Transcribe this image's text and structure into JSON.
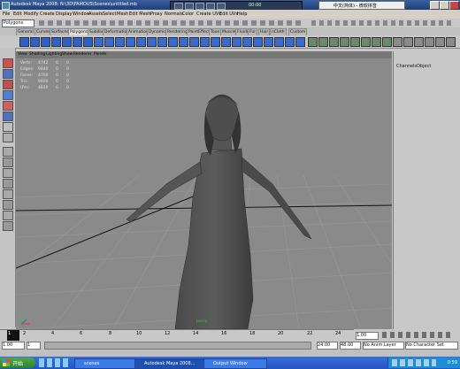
{
  "window": {
    "title": "Autodesk Maya 2008: N:\\3D\\FAMOUS\\Scenes\\untitled.mb",
    "media_time": "00:00"
  },
  "ime": {
    "label": "中文(简体) - 微软拼音"
  },
  "menus": [
    "File",
    "Edit",
    "Modify",
    "Create",
    "Display",
    "Window",
    "Assets",
    "Select",
    "Mesh",
    "Edit Mesh",
    "Proxy",
    "Normals",
    "Color",
    "Create UVs",
    "Edit UVs",
    "Help"
  ],
  "status": {
    "mode": "Polygons"
  },
  "shelf_tabs": [
    "General",
    "Curves",
    "Surfaces",
    "Polygons",
    "Subdivs",
    "Deformation",
    "Animation",
    "Dynamics",
    "Rendering",
    "PaintEffects",
    "Toon",
    "Muscle",
    "Fluids",
    "Fur",
    "Hair",
    "nCloth",
    "Custom"
  ],
  "viewport": {
    "menu": [
      "View",
      "Shading",
      "Lighting",
      "Show",
      "Renderer",
      "Panels"
    ],
    "hud": [
      {
        "label": "Verts:",
        "value": "4742",
        "a": "0",
        "b": "0"
      },
      {
        "label": "Edges:",
        "value": "9440",
        "a": "0",
        "b": "0"
      },
      {
        "label": "Faces:",
        "value": "4700",
        "a": "0",
        "b": "0"
      },
      {
        "label": "Tris:",
        "value": "9400",
        "a": "0",
        "b": "0"
      },
      {
        "label": "UVs:",
        "value": "4820",
        "a": "0",
        "b": "0"
      }
    ],
    "camera_label": "persp"
  },
  "channel_box": {
    "tabs": [
      "Channels",
      "Object"
    ]
  },
  "timeline": {
    "ticks": [
      "1",
      "2",
      "4",
      "6",
      "8",
      "10",
      "12",
      "14",
      "16",
      "18",
      "20",
      "22",
      "24"
    ],
    "current_frame": "1.00"
  },
  "range": {
    "start": "1.00",
    "mid_start": "1",
    "end": "24.00",
    "end_total": "48.00",
    "anim_layer": "No Anim Layer",
    "char_set": "No Character Set"
  },
  "taskbar": {
    "start_label": "开始",
    "tasks": [
      "scenes",
      "Autodesk Maya 2008...",
      "Output Window"
    ],
    "clock": "0:59"
  }
}
